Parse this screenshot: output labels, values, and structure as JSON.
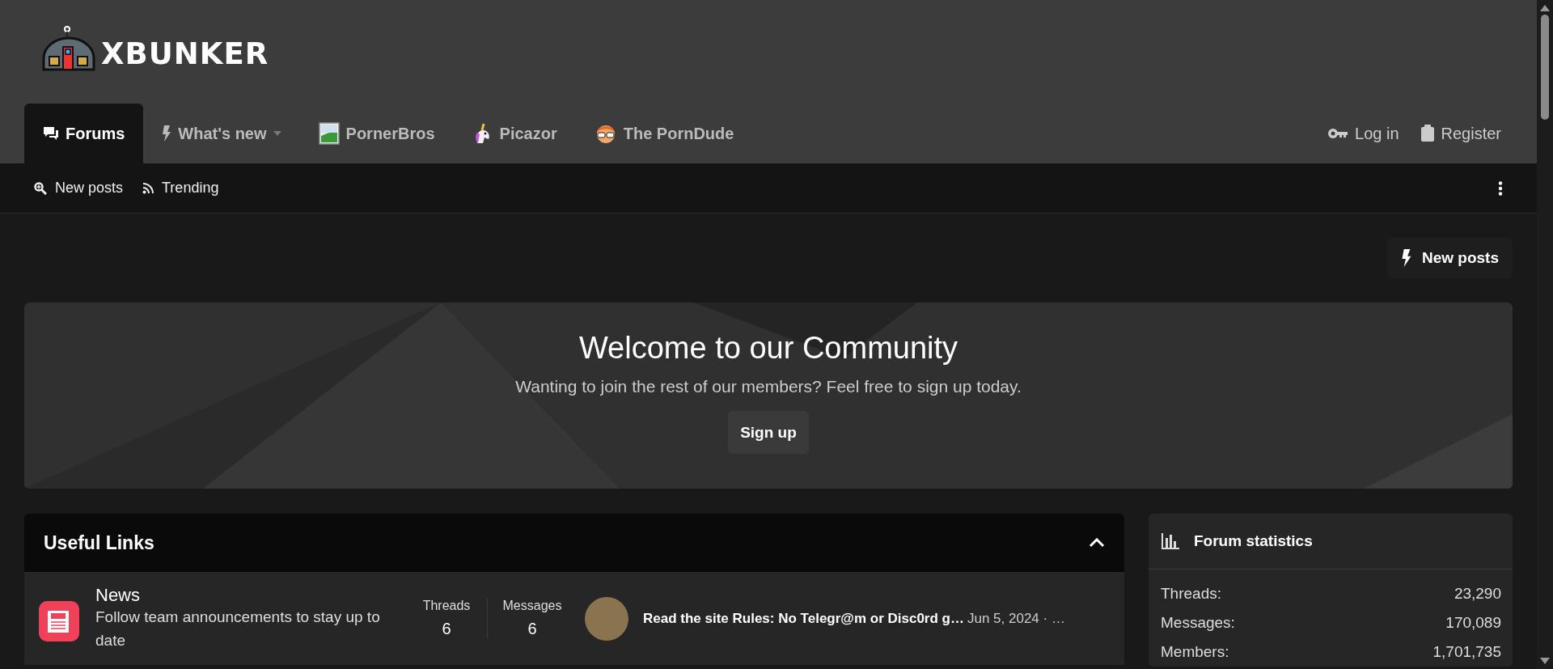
{
  "header": {
    "logo_text": "XBUNKER"
  },
  "nav": {
    "tabs": [
      {
        "label": "Forums",
        "selected": true,
        "has_menu": false
      },
      {
        "label": "What's new",
        "selected": false,
        "has_menu": true
      },
      {
        "label": "PornerBros",
        "selected": false,
        "has_menu": false
      },
      {
        "label": "Picazor",
        "selected": false,
        "has_menu": false
      },
      {
        "label": "The PornDude",
        "selected": false,
        "has_menu": false
      }
    ],
    "account": [
      "Log in",
      "Register"
    ]
  },
  "subnav": {
    "links": [
      "New posts",
      "Trending"
    ]
  },
  "new_posts_button": "New posts",
  "welcome": {
    "title": "Welcome to our Community",
    "text": "Wanting to join the rest of our members? Feel free to sign up today.",
    "button": "Sign up"
  },
  "category": {
    "title": "Useful Links",
    "expanded": true,
    "forums": [
      {
        "name": "News",
        "description": "Follow team announcements to stay up to date",
        "threads_label": "Threads",
        "threads": "6",
        "messages_label": "Messages",
        "messages": "6",
        "last_post_title": "Read the site Rules: No Telegr@m or Disc0rd g…",
        "last_post_meta": "Jun 5, 2024 · …"
      }
    ]
  },
  "forum_statistics": {
    "title": "Forum statistics",
    "rows": [
      {
        "label": "Threads:",
        "value": "23,290"
      },
      {
        "label": "Messages:",
        "value": "170,089"
      },
      {
        "label": "Members:",
        "value": "1,701,735"
      }
    ]
  }
}
